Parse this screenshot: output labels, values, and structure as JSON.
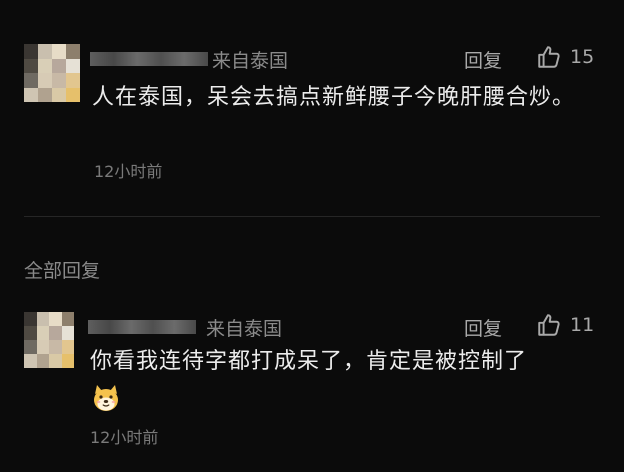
{
  "top_comment": {
    "location": "来自泰国",
    "reply_label": "回复",
    "likes": "15",
    "text": "人在泰国，呆会去搞点新鲜腰子今晚肝腰合炒。",
    "time": "12小时前"
  },
  "section": {
    "title": "全部回复"
  },
  "reply_comment": {
    "location": "来自泰国",
    "reply_label": "回复",
    "likes": "11",
    "text": "你看我连待字都打成呆了，肯定是被控制了",
    "emoji": "doge-icon",
    "time": "12小时前"
  },
  "colors": {
    "background": "#0b0b0b",
    "text": "#ececec",
    "muted": "#8a8a8a"
  }
}
